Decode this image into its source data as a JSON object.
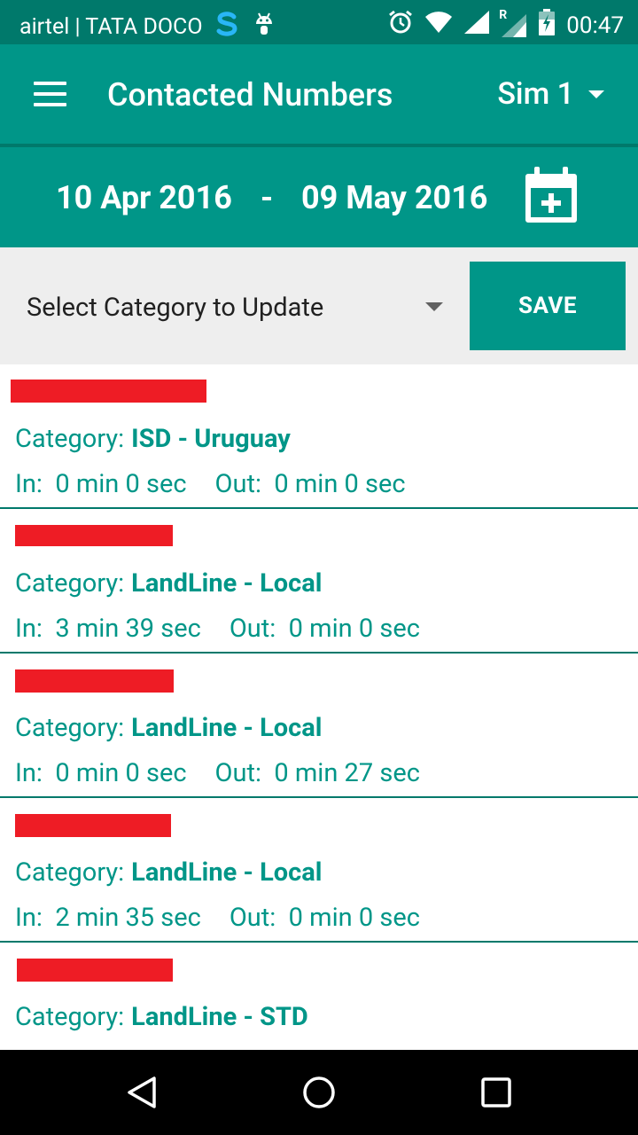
{
  "status_bar": {
    "carrier": "airtel | TATA DOCO",
    "roaming_label": "R",
    "time": "00:47",
    "icons": [
      "app-s-icon",
      "android-debug-icon",
      "alarm-icon",
      "wifi-icon",
      "signal-icon",
      "signal-roaming-icon",
      "battery-charging-icon"
    ]
  },
  "app_bar": {
    "title": "Contacted Numbers",
    "sim_label": "Sim 1",
    "menu_icon": "hamburger-menu-icon",
    "dropdown_icon": "caret-down-icon"
  },
  "date_range": {
    "start": "10 Apr 2016",
    "separator": "-",
    "end": "09 May 2016",
    "icon": "calendar-add-icon"
  },
  "filter": {
    "category_placeholder": "Select Category to Update",
    "save_label": "SAVE"
  },
  "contacts": [
    {
      "category_label": "Category:",
      "category": "ISD - Uruguay",
      "in_label": "In:",
      "in": "0 min 0 sec",
      "out_label": "Out:",
      "out": "0 min 0 sec"
    },
    {
      "category_label": "Category:",
      "category": "LandLine - Local",
      "in_label": "In:",
      "in": "3 min 39 sec",
      "out_label": "Out:",
      "out": "0 min 0 sec"
    },
    {
      "category_label": "Category:",
      "category": "LandLine - Local",
      "in_label": "In:",
      "in": "0 min 0 sec",
      "out_label": "Out:",
      "out": "0 min 27 sec"
    },
    {
      "category_label": "Category:",
      "category": "LandLine - Local",
      "in_label": "In:",
      "in": "2 min 35 sec",
      "out_label": "Out:",
      "out": "0 min 0 sec"
    },
    {
      "category_label": "Category:",
      "category": "LandLine - STD",
      "in_label": "",
      "in": "",
      "out_label": "",
      "out": ""
    }
  ],
  "colors": {
    "primary": "#009688",
    "primary_dark": "#00796b",
    "redaction": "#ee1c25",
    "filter_background": "#eeeeee"
  },
  "nav_bar": {
    "icons": [
      "back-triangle-icon",
      "home-circle-icon",
      "recents-square-icon"
    ]
  }
}
